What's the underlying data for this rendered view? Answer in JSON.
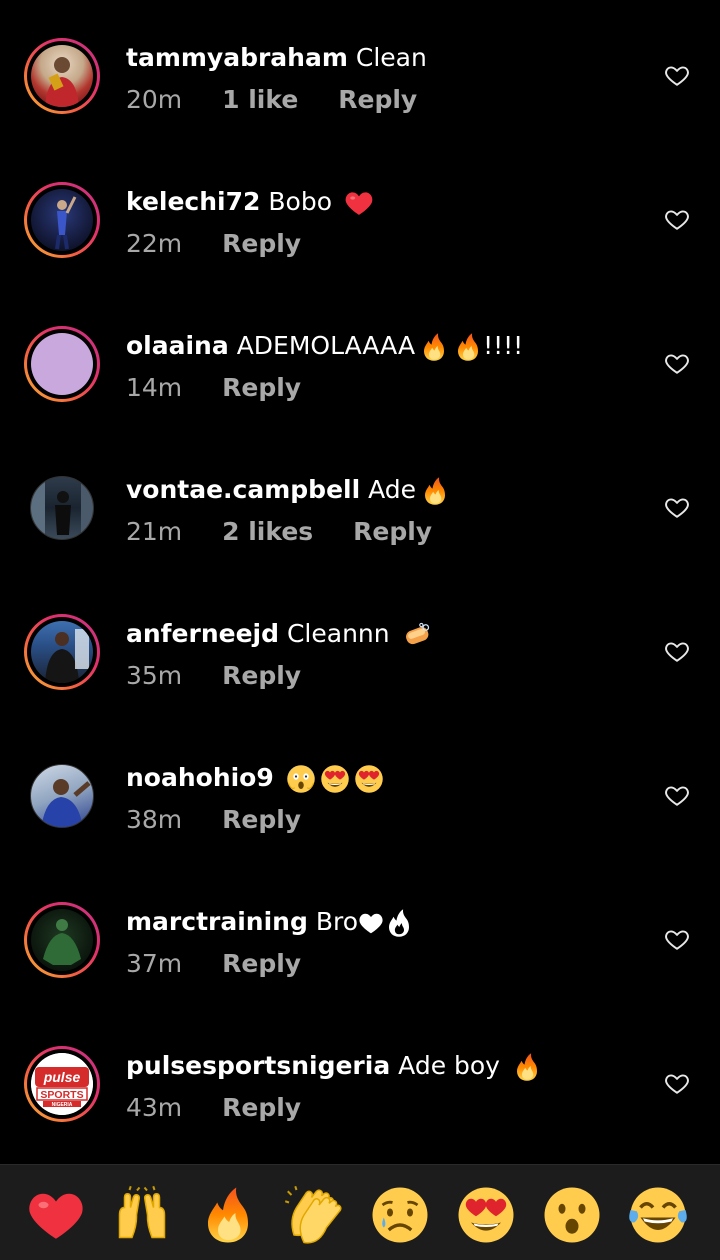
{
  "comments": [
    {
      "username": "tammyabraham",
      "text": "Clean",
      "time": "20m",
      "likes": "1 like",
      "reply": "Reply",
      "emojis": []
    },
    {
      "username": "kelechi72",
      "text": "Bobo",
      "time": "22m",
      "likes": "",
      "reply": "Reply",
      "emojis": [
        "red-heart"
      ]
    },
    {
      "username": "olaaina",
      "text": "ADEMOLAAAA",
      "suffix": "!!!!",
      "time": "14m",
      "likes": "",
      "reply": "Reply",
      "emojis": [
        "fire",
        "fire"
      ]
    },
    {
      "username": "vontae.campbell",
      "text": "Ade",
      "time": "21m",
      "likes": "2 likes",
      "reply": "Reply",
      "emojis": [
        "fire"
      ]
    },
    {
      "username": "anferneejd",
      "text": "Cleannn",
      "time": "35m",
      "likes": "",
      "reply": "Reply",
      "emojis": [
        "soap"
      ]
    },
    {
      "username": "noahohio9",
      "text": "",
      "time": "38m",
      "likes": "",
      "reply": "Reply",
      "emojis": [
        "face-screaming",
        "heart-eyes",
        "heart-eyes"
      ]
    },
    {
      "username": "marctraining",
      "text": "Bro",
      "time": "37m",
      "likes": "",
      "reply": "Reply",
      "emojis": [
        "white-heart",
        "white-fire"
      ]
    },
    {
      "username": "pulsesportsnigeria",
      "text": "Ade boy",
      "time": "43m",
      "likes": "",
      "reply": "Reply",
      "emojis": [
        "fire"
      ]
    }
  ],
  "avatar_logo": {
    "line1": "pulse",
    "line2": "SPORTS",
    "line3": "NIGERIA"
  },
  "quick_reactions": [
    "red-heart",
    "raising-hands",
    "fire",
    "clapping-hands",
    "sad-face",
    "heart-eyes",
    "surprised-face",
    "tears-of-joy"
  ],
  "colors": {
    "background": "#000000",
    "secondary_text": "#a8a8a8",
    "bar": "#1c1c1c"
  }
}
